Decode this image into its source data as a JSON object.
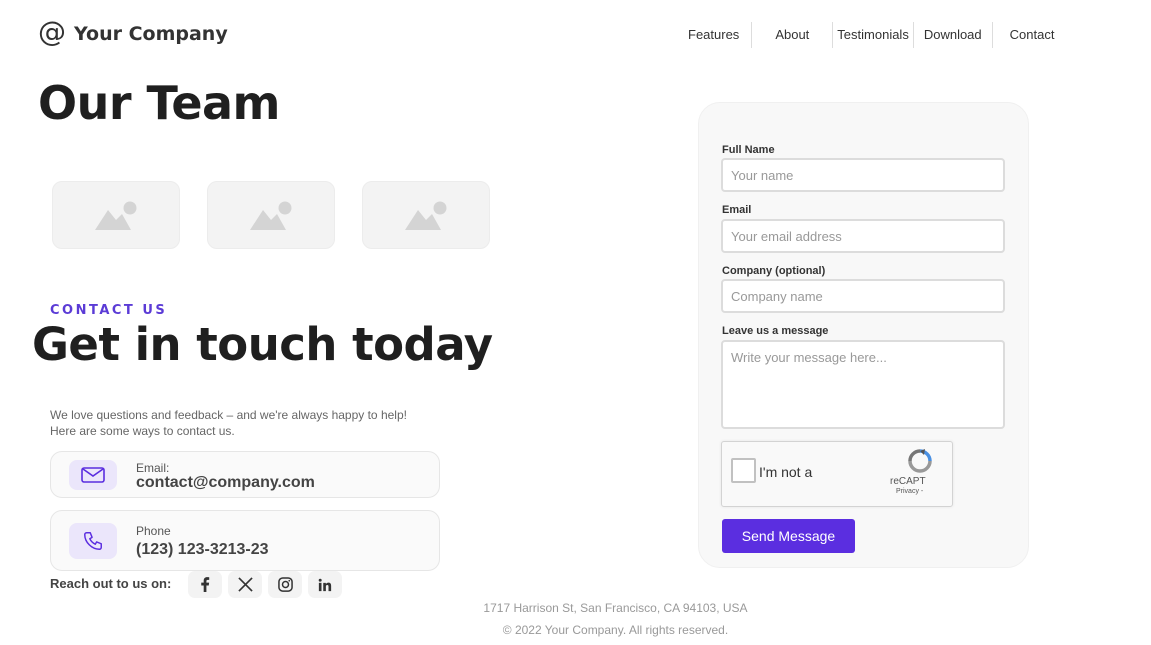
{
  "brand": {
    "logo_symbol": "@",
    "name": "Your Company"
  },
  "nav": {
    "items": [
      "Features",
      "About",
      "Testimonials",
      "Download",
      "Contact"
    ]
  },
  "team": {
    "title": "Our Team",
    "placeholder_icons": [
      "image-placeholder-icon",
      "image-placeholder-icon",
      "image-placeholder-icon"
    ]
  },
  "contact": {
    "eyebrow": "CONTACT US",
    "title": "Get in touch today",
    "intro_line1": "We love questions and feedback – and we're always happy to help!",
    "intro_line2": "Here are some ways to contact us.",
    "email": {
      "label": "Email:",
      "value": "contact@company.com",
      "icon": "mail-icon"
    },
    "phone": {
      "label": "Phone",
      "value": "(123) 123-3213-23",
      "icon": "phone-icon"
    },
    "reach_label": "Reach out to us on:",
    "social_icons": [
      "facebook-icon",
      "x-icon",
      "instagram-icon",
      "linkedin-icon"
    ]
  },
  "form": {
    "full_name": {
      "label": "Full Name",
      "placeholder": "Your name"
    },
    "email": {
      "label": "Email",
      "placeholder": "Your email address"
    },
    "company": {
      "label": "Company (optional)",
      "placeholder": "Company name"
    },
    "message": {
      "label": "Leave us a message",
      "placeholder": "Write your message here..."
    },
    "captcha": {
      "text": "I'm not a",
      "brand": "reCAPT",
      "privacy": "Privacy -"
    },
    "submit_label": "Send Message"
  },
  "footer": {
    "address": "1717 Harrison St, San Francisco, CA 94103, USA",
    "copyright": "© 2022 Your Company.  All rights reserved."
  },
  "colors": {
    "accent": "#5b2ee0",
    "eyebrow": "#5b3bd6",
    "icon_bg": "#ebe6fb"
  }
}
